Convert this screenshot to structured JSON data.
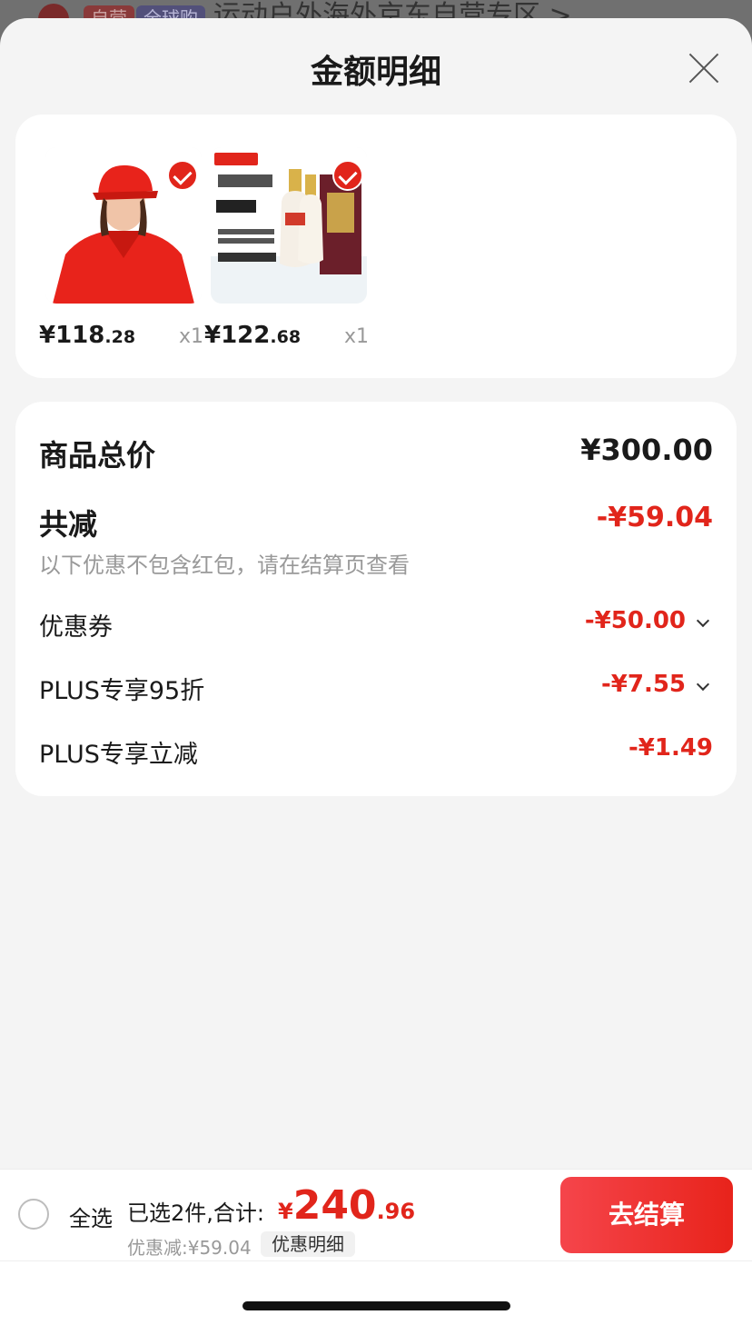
{
  "background": {
    "tag_self": "自营",
    "tag_global": "全球购",
    "title": "运动户外海外京东自营专区 >"
  },
  "sheet": {
    "title": "金额明细"
  },
  "products": [
    {
      "price_int": "¥118",
      "price_dec": ".28",
      "qty": "x1"
    },
    {
      "price_int": "¥122",
      "price_dec": ".68",
      "qty": "x1"
    }
  ],
  "summary": {
    "total_label": "商品总价",
    "total_value": "¥300.00",
    "reduce_label": "共减",
    "reduce_value": "-¥59.04",
    "note": "以下优惠不包含红包，请在结算页查看",
    "items": [
      {
        "label": "优惠券",
        "value": "-¥50.00"
      },
      {
        "label": "PLUS专享95折",
        "value": "-¥7.55"
      },
      {
        "label": "PLUS专享立减",
        "value": "-¥1.49"
      }
    ]
  },
  "footer": {
    "select_all": "全选",
    "selected_text": "已选2件,合计:",
    "sum_yen": "¥",
    "sum_int": "240",
    "sum_dec": ".96",
    "discount": "优惠减:¥59.04",
    "detail_btn": "优惠明细",
    "checkout": "去结算"
  },
  "colors": {
    "accent": "#e1251b",
    "muted": "#999999"
  }
}
